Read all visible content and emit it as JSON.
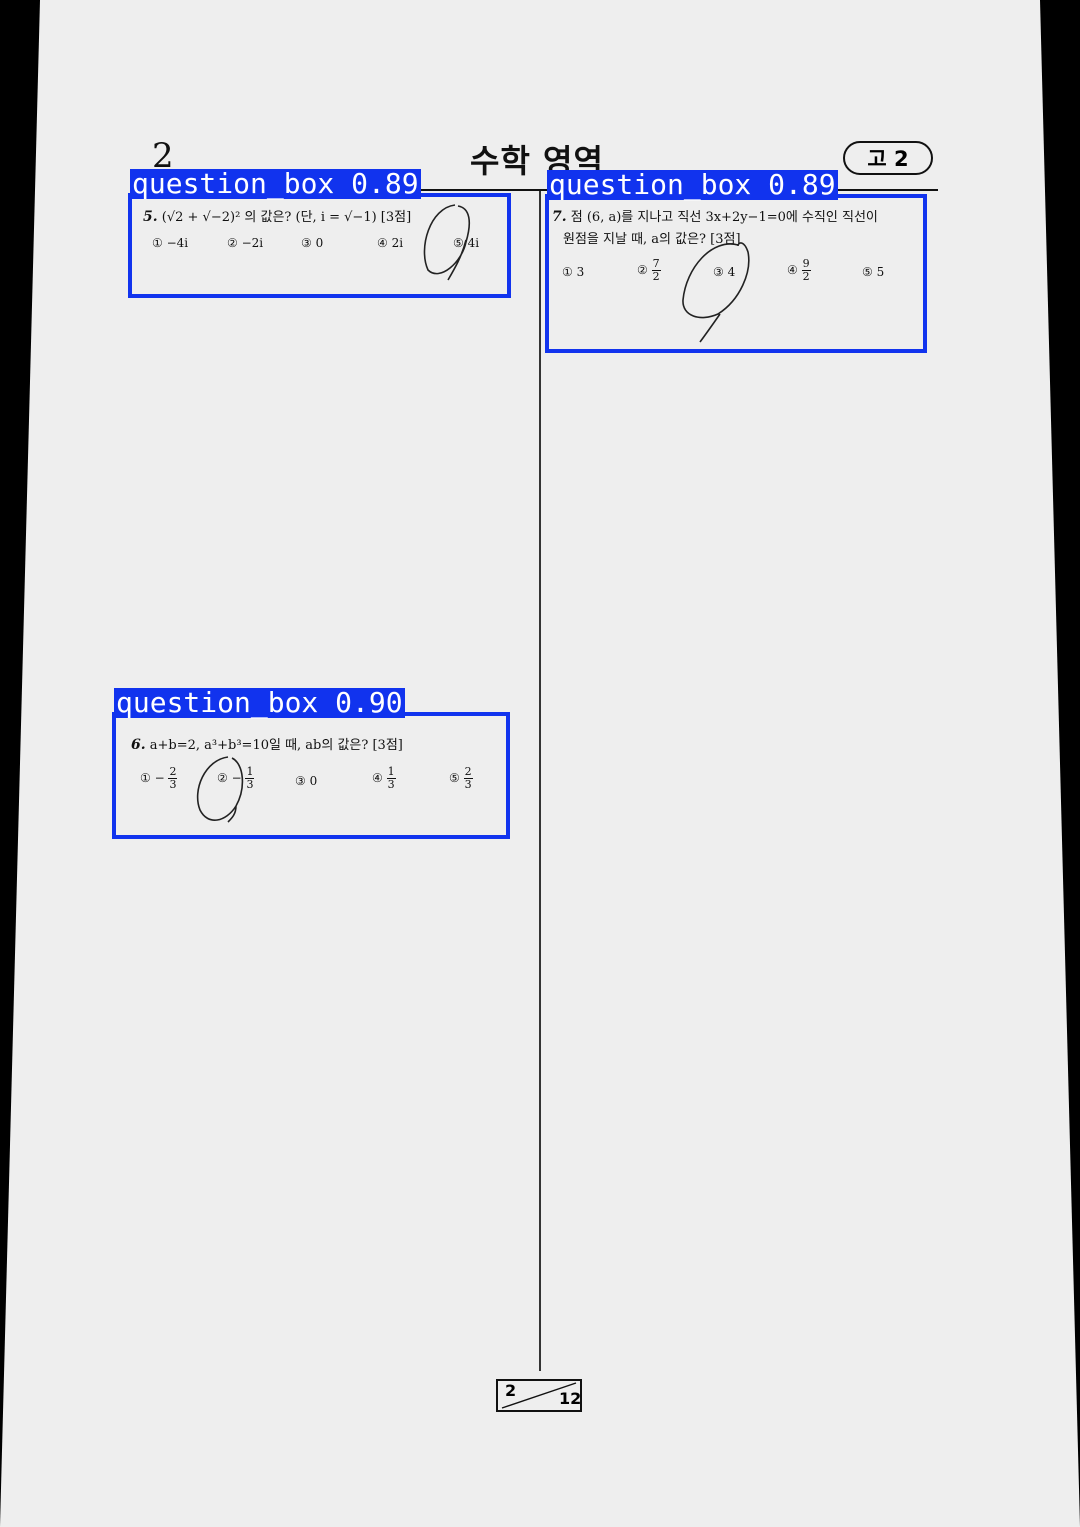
{
  "header": {
    "page_left": "2",
    "title": "수학 영역",
    "grade": "고 2"
  },
  "detections": [
    {
      "label": "question_box 0.89"
    },
    {
      "label": "question_box 0.89"
    },
    {
      "label": "question_box 0.90"
    }
  ],
  "questions": {
    "q5": {
      "number": "5.",
      "text": "(√2 + √−2)² 의 값은? (단, i = √−1) [3점]",
      "options": [
        "① −4i",
        "② −2i",
        "③ 0",
        "④ 2i",
        "⑤ 4i"
      ]
    },
    "q7": {
      "number": "7.",
      "line1": "점 (6, a)를 지나고 직선 3x+2y−1=0에 수직인 직선이",
      "line2": "원점을 지날 때, a의 값은? [3점]",
      "options": [
        {
          "marker": "①",
          "value": "3"
        },
        {
          "marker": "②",
          "num": "7",
          "den": "2"
        },
        {
          "marker": "③",
          "value": "4"
        },
        {
          "marker": "④",
          "num": "9",
          "den": "2"
        },
        {
          "marker": "⑤",
          "value": "5"
        }
      ]
    },
    "q6": {
      "number": "6.",
      "text": "a+b=2, a³+b³=10일 때, ab의 값은? [3점]",
      "options": [
        {
          "marker": "①",
          "sign": "−",
          "num": "2",
          "den": "3"
        },
        {
          "marker": "②",
          "sign": "−",
          "num": "1",
          "den": "3"
        },
        {
          "marker": "③",
          "value": "0"
        },
        {
          "marker": "④",
          "num": "1",
          "den": "3"
        },
        {
          "marker": "⑤",
          "num": "2",
          "den": "3"
        }
      ]
    }
  },
  "footer": {
    "current_page": "2",
    "total_pages": "12"
  },
  "colors": {
    "detection_box": "#1133ee",
    "paper": "#eeeeee",
    "background": "#000000"
  }
}
